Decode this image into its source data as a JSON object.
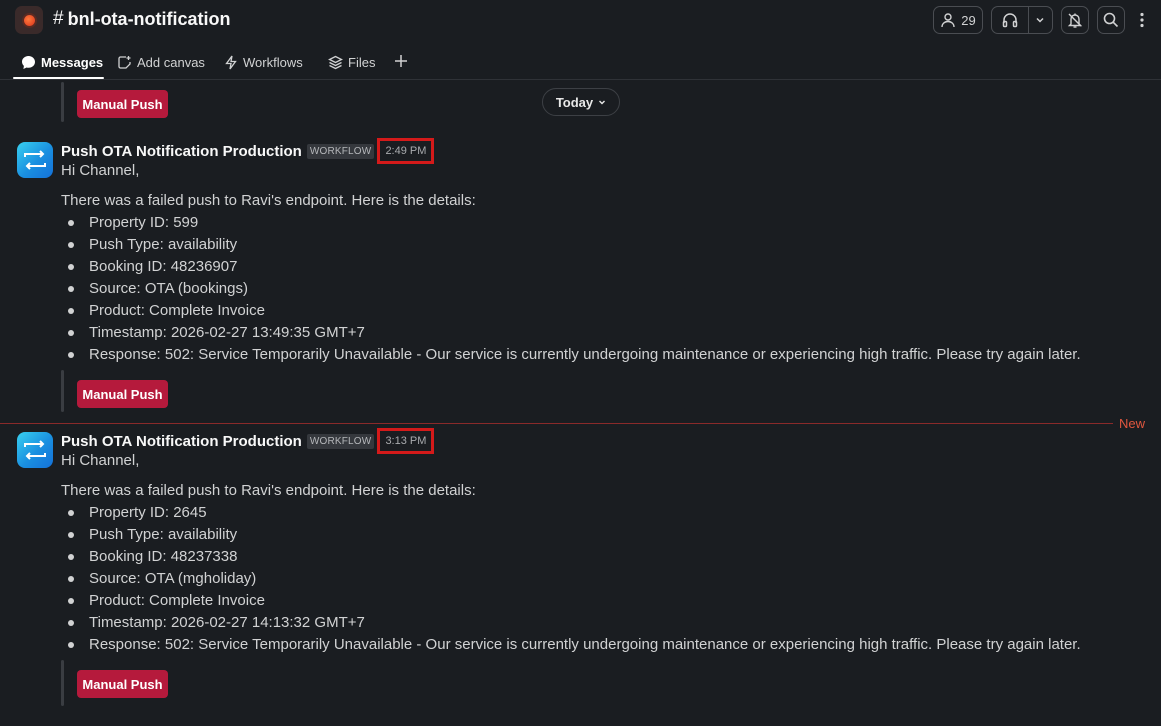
{
  "channel": {
    "name": "bnl-ota-notification",
    "hash": "#",
    "member_count": "29"
  },
  "tabs": [
    {
      "label": "Messages"
    },
    {
      "label": "Add canvas"
    },
    {
      "label": "Workflows"
    },
    {
      "label": "Files"
    }
  ],
  "date_divider": "Today",
  "action_label": "Manual Push",
  "new_label": "New",
  "messages": [
    {
      "sender": "Push OTA Notification Production",
      "badge": "WORKFLOW",
      "time": "2:49 PM",
      "greeting": "Hi Channel,",
      "intro": "There was a failed push to Ravi's endpoint. Here is the details:",
      "details": [
        "Property ID: 599",
        "Push Type: availability",
        "Booking ID: 48236907",
        "Source: OTA (bookings)",
        "Product: Complete Invoice",
        "Timestamp: 2026-02-27 13:49:35 GMT+7",
        "Response: 502: Service Temporarily Unavailable - Our service is currently undergoing maintenance or experiencing high traffic. Please try again later."
      ]
    },
    {
      "sender": "Push OTA Notification Production",
      "badge": "WORKFLOW",
      "time": "3:13 PM",
      "greeting": "Hi Channel,",
      "intro": "There was a failed push to Ravi's endpoint. Here is the details:",
      "details": [
        "Property ID: 2645",
        "Push Type: availability",
        "Booking ID: 48237338",
        "Source: OTA (mgholiday)",
        "Product: Complete Invoice",
        "Timestamp: 2026-02-27 14:13:32 GMT+7",
        "Response: 502: Service Temporarily Unavailable - Our service is currently undergoing maintenance or experiencing high traffic. Please try again later."
      ]
    }
  ]
}
